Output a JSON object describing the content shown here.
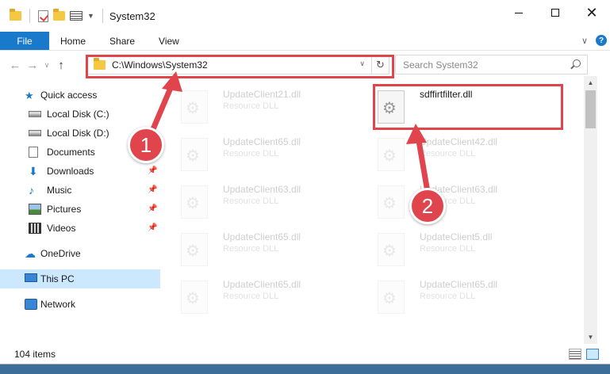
{
  "window": {
    "title": "System32",
    "controls": {
      "minimize": "minimize-icon",
      "maximize": "maximize-icon",
      "close": "close-icon"
    }
  },
  "ribbon": {
    "tabs": [
      "File",
      "Home",
      "Share",
      "View"
    ],
    "help": "?"
  },
  "address_bar": {
    "path": "C:\\Windows\\System32",
    "search_placeholder": "Search System32"
  },
  "sidebar": {
    "quick_access": "Quick access",
    "items": [
      {
        "label": "Local Disk (C:)",
        "icon": "drive-icon",
        "pinned": false
      },
      {
        "label": "Local Disk (D:)",
        "icon": "drive-icon",
        "pinned": false
      },
      {
        "label": "Documents",
        "icon": "documents-icon",
        "pinned": false
      },
      {
        "label": "Downloads",
        "icon": "downloads-icon",
        "pinned": true
      },
      {
        "label": "Music",
        "icon": "music-icon",
        "pinned": true
      },
      {
        "label": "Pictures",
        "icon": "pictures-icon",
        "pinned": true
      },
      {
        "label": "Videos",
        "icon": "videos-icon",
        "pinned": true
      }
    ],
    "onedrive": "OneDrive",
    "this_pc": "This PC",
    "network": "Network"
  },
  "files": [
    {
      "name": "UpdateClient21.dll",
      "type": "Resource DLL",
      "highlighted": false
    },
    {
      "name": "sdffirtfilter.dll",
      "type": "",
      "highlighted": true
    },
    {
      "name": "UpdateClient65.dll",
      "type": "Resource DLL",
      "highlighted": false
    },
    {
      "name": "UpdateClient42.dll",
      "type": "Resource DLL",
      "highlighted": false
    },
    {
      "name": "UpdateClient63.dll",
      "type": "Resource DLL",
      "highlighted": false
    },
    {
      "name": "UpdateClient63.dll",
      "type": "Resource DLL",
      "highlighted": false
    },
    {
      "name": "UpdateClient65.dll",
      "type": "Resource DLL",
      "highlighted": false
    },
    {
      "name": "UpdateClient5.dll",
      "type": "Resource DLL",
      "highlighted": false
    },
    {
      "name": "UpdateClient65.dll",
      "type": "Resource DLL",
      "highlighted": false
    },
    {
      "name": "UpdateClient65.dll",
      "type": "Resource DLL",
      "highlighted": false
    }
  ],
  "status": {
    "items": "104 items"
  },
  "annotations": {
    "step1": "1",
    "step2": "2",
    "color": "#e0454d"
  }
}
